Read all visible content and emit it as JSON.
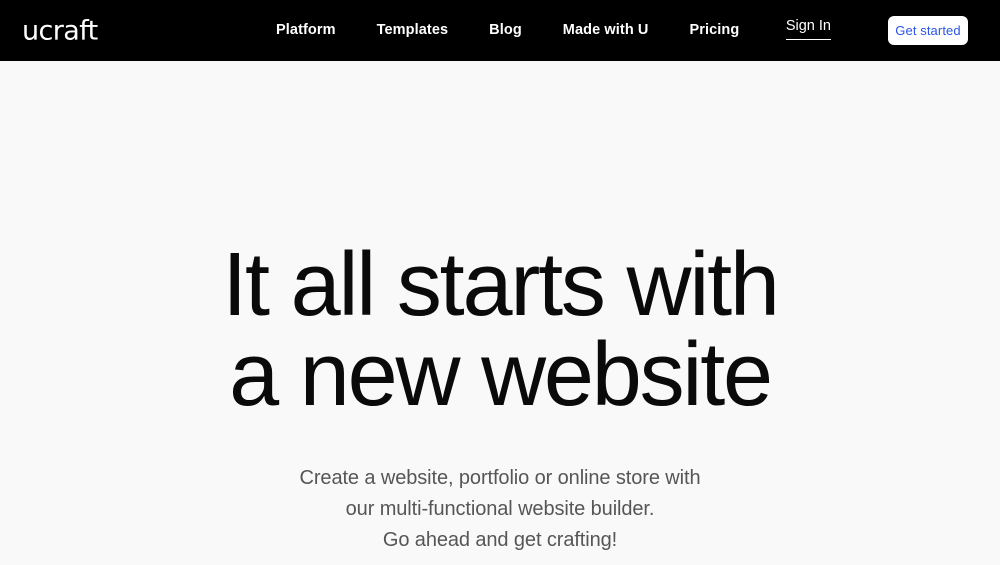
{
  "header": {
    "background_color": "#000000",
    "logo": {
      "text": "ucraft",
      "color": "#ffffff"
    },
    "nav_items": [
      {
        "label": "Platform"
      },
      {
        "label": "Templates"
      },
      {
        "label": "Blog"
      },
      {
        "label": "Made with U"
      },
      {
        "label": "Pricing"
      }
    ],
    "sign_in_label": "Sign In",
    "cta": {
      "label": "Get started",
      "text_color": "#2b55e8",
      "background_color": "#ffffff"
    }
  },
  "hero": {
    "background_color": "#f9f9f9",
    "headline_lines": [
      "It all starts with",
      "a new website"
    ],
    "headline_color": "#0a0a0a",
    "subtitle_lines": [
      "Create a website, portfolio or online store with",
      "our multi-functional website builder.",
      "Go ahead and get crafting!"
    ],
    "subtitle_color": "#565656"
  }
}
